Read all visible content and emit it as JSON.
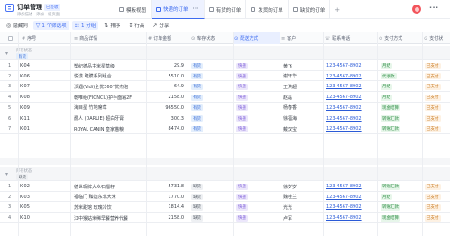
{
  "header": {
    "title": "订单管理",
    "tag": "已签收",
    "meta": "添加描述 · 添加一级页面",
    "views": [
      {
        "label": "模板视图",
        "active": false
      },
      {
        "label": "快递的订单",
        "active": true
      },
      {
        "label": "有货的订单",
        "active": false
      },
      {
        "label": "发货的订单",
        "active": false
      },
      {
        "label": "缺货的订单",
        "active": false
      }
    ],
    "add_view": "+",
    "more": "···"
  },
  "toolbar": {
    "hide": "隐藏列",
    "filter": "1 个筛选项",
    "group": "1 分组",
    "sort": "排序",
    "row_height": "行高",
    "share": "分享"
  },
  "columns": [
    "序号",
    "商品详情",
    "订单金额",
    "库存状态",
    "配送方式",
    "客户",
    "联系电话",
    "支付方式",
    "支付状"
  ],
  "groups": [
    {
      "caption": "库存状态",
      "tag": "有货",
      "rows": [
        {
          "no": "1",
          "id": "K-04",
          "product": "塑纪德品主米星草级",
          "amount": "29.9",
          "stock": "有货",
          "ship": "快递",
          "customer": "黄飞",
          "phone": "123-4567-8902",
          "pay": "月结",
          "status": "已支付"
        },
        {
          "no": "2",
          "id": "K-06",
          "product": "悦漾 睫膜系列组合",
          "amount": "5510.0",
          "stock": "有货",
          "ship": "快递",
          "customer": "谢轩华",
          "phone": "123-4567-8902",
          "pay": "代收款",
          "status": "已支付"
        },
        {
          "no": "3",
          "id": "K-07",
          "product": "沃遇(Vidi)全优360°优杰泡",
          "amount": "64.9",
          "stock": "有货",
          "ship": "快递",
          "customer": "王洪超",
          "phone": "123-4567-8902",
          "pay": "月结",
          "status": "已支付"
        },
        {
          "no": "4",
          "id": "K-08",
          "product": "乾唯组(FIONCU)护手面霜2F",
          "amount": "2158.0",
          "stock": "有货",
          "ship": "快递",
          "customer": "赵磊",
          "phone": "123-4567-8902",
          "pay": "月结",
          "status": "已支付"
        },
        {
          "no": "5",
          "id": "K-09",
          "product": "海目星 竹地席草",
          "amount": "96550.0",
          "stock": "有货",
          "ship": "快递",
          "customer": "杨春香",
          "phone": "123-4567-8902",
          "pay": "现金结算",
          "status": "已支付"
        },
        {
          "no": "6",
          "id": "K-11",
          "product": "爵人 (DARLIE) 超白牙膏",
          "amount": "300.3",
          "stock": "有货",
          "ship": "快递",
          "customer": "徐福海",
          "phone": "123-4567-8902",
          "pay": "转账汇款",
          "status": "已支付"
        },
        {
          "no": "7",
          "id": "K-01",
          "product": "ROYAL CANIN 皇家猫粮",
          "amount": "8474.0",
          "stock": "有货",
          "ship": "快递",
          "customer": "戴双宝",
          "phone": "123-4567-8902",
          "pay": "转账汇款",
          "status": "已支付"
        }
      ]
    },
    {
      "caption": "库存状态",
      "tag": "缺货",
      "rows": [
        {
          "no": "1",
          "id": "K-02",
          "product": "德世瑕牌大众石榴籽",
          "amount": "5731.8",
          "stock": "缺货",
          "ship": "快递",
          "customer": "徐岁岁",
          "phone": "123-4567-8902",
          "pay": "转账汇款",
          "status": "已支付"
        },
        {
          "no": "2",
          "id": "K-03",
          "product": "福临门 臻选东北大米",
          "amount": "1770.0",
          "stock": "缺货",
          "ship": "快递",
          "customer": "魏桂兰",
          "phone": "123-4567-8902",
          "pay": "月结",
          "status": "已支付"
        },
        {
          "no": "3",
          "id": "K-05",
          "product": "苏米甜馆 玫瑰冷饮",
          "amount": "1814.4",
          "stock": "缺货",
          "ship": "快递",
          "customer": "光光",
          "phone": "123-4567-8902",
          "pay": "转账汇款",
          "status": "已支付"
        },
        {
          "no": "4",
          "id": "K-10",
          "product": "江中猴姑米稀早餐营养代餐",
          "amount": "2158.0",
          "stock": "缺货",
          "ship": "快递",
          "customer": "卢军",
          "phone": "123-4567-8902",
          "pay": "现金结算",
          "status": "已支付"
        }
      ]
    }
  ],
  "colors": {
    "accent": "#3d6bf0",
    "in_stock_bg": "#e3eefc",
    "in_stock_fg": "#3a6fd8",
    "out_stock_bg": "#eef0f3",
    "out_stock_fg": "#4f5660",
    "ship_bg": "#ece7fb",
    "ship_fg": "#7a5ad8",
    "pay_bg": "#e7f6ea",
    "pay_fg": "#2f8f46",
    "status_bg": "#fdf1e3",
    "status_fg": "#c97a1f"
  }
}
